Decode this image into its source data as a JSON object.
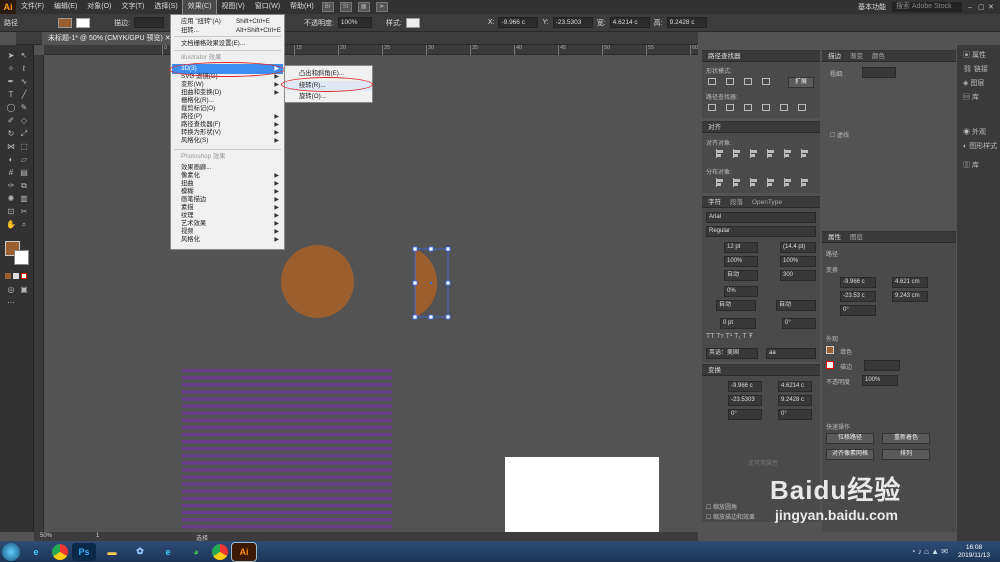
{
  "app": {
    "logo": "Ai",
    "workspace": "基本功能",
    "search_placeholder": "搜索 Adobe Stock"
  },
  "menubar": {
    "items": [
      "文件(F)",
      "编辑(E)",
      "对象(O)",
      "文字(T)",
      "选择(S)",
      "效果(C)",
      "视图(V)",
      "窗口(W)",
      "帮助(H)"
    ],
    "active": "效果(C)",
    "toolbar_icons": [
      "Br",
      "St"
    ]
  },
  "control_bar": {
    "selection": "路径",
    "fill_color": "#9b5e2c",
    "stroke_label": "描边:",
    "opacity_label": "不透明度:",
    "opacity": "100%",
    "style_label": "样式:",
    "x_label": "X:",
    "x": "-9.966 c",
    "y_label": "Y:",
    "y": "-23.5303",
    "w_label": "宽:",
    "w": "4.6214 c",
    "h_label": "高:",
    "h": "9.2428 c"
  },
  "document": {
    "tab": "未标题-1* @ 50% (CMYK/GPU 预览)",
    "zoom": "50%",
    "page": "1",
    "status": "选择"
  },
  "ruler_h": [
    "0",
    "5",
    "10",
    "15",
    "20",
    "25",
    "30",
    "35",
    "40",
    "45",
    "50",
    "55",
    "60"
  ],
  "effect_menu": {
    "items": [
      {
        "label": "应用 \"扭转\"(A)",
        "shortcut": "Shift+Ctrl+E"
      },
      {
        "label": "扭转...",
        "shortcut": "Alt+Shift+Ctrl+E"
      },
      {
        "label": "文档栅格效果设置(E)..."
      },
      {
        "label": "Illustrator 效果",
        "header": true
      },
      {
        "label": "3D(3)",
        "submenu": true,
        "highlight": true
      },
      {
        "label": "SVG 滤镜(G)",
        "submenu": true
      },
      {
        "label": "变形(W)",
        "submenu": true
      },
      {
        "label": "扭曲和变换(D)",
        "submenu": true
      },
      {
        "label": "栅格化(R)..."
      },
      {
        "label": "裁剪标记(O)"
      },
      {
        "label": "路径(P)",
        "submenu": true
      },
      {
        "label": "路径查找器(F)",
        "submenu": true
      },
      {
        "label": "转换为形状(V)",
        "submenu": true
      },
      {
        "label": "风格化(S)",
        "submenu": true
      },
      {
        "label": "Photoshop 效果",
        "header": true
      },
      {
        "label": "效果画廊..."
      },
      {
        "label": "像素化",
        "submenu": true
      },
      {
        "label": "扭曲",
        "submenu": true
      },
      {
        "label": "模糊",
        "submenu": true
      },
      {
        "label": "画笔描边",
        "submenu": true
      },
      {
        "label": "素描",
        "submenu": true
      },
      {
        "label": "纹理",
        "submenu": true
      },
      {
        "label": "艺术效果",
        "submenu": true
      },
      {
        "label": "视频",
        "submenu": true
      },
      {
        "label": "风格化",
        "submenu": true
      }
    ]
  },
  "submenu_3d": {
    "items": [
      "凸出和斜角(E)...",
      "绕转(R)...",
      "旋转(O)..."
    ],
    "highlight": "绕转(R)..."
  },
  "panels": {
    "pathfinder": {
      "title": "路径查找器",
      "shape_modes": "形状模式:",
      "expand": "扩展",
      "pathfinders": "路径查找器:"
    },
    "align": {
      "title": "对齐",
      "align_objects": "对齐对象:",
      "distribute": "分布对象:"
    },
    "character": {
      "tabs": [
        "字符",
        "段落",
        "OpenType"
      ],
      "font": "Arial",
      "style": "Regular",
      "size": "12 pt",
      "leading": "(14.4 pt)",
      "scale_h": "100%",
      "scale_v": "100%",
      "kerning": "自动",
      "tracking": "300",
      "tsume": "0%",
      "aki1": "自动",
      "aki2": "自动",
      "baseline": "0 pt",
      "rotation": "0°",
      "language": "英语：美国",
      "aa": "aa"
    },
    "transform": {
      "title": "变换",
      "x": "-9.966 c",
      "y": "-23.5303",
      "w": "4.6214 c",
      "h": "9.2428 c",
      "angle": "0°",
      "shear": "0°",
      "note": "无可用属性",
      "scale_corners": "缩放圆角",
      "scale_strokes": "缩放描边和效果"
    },
    "stroke": {
      "tabs": [
        "描边",
        "渐变",
        "颜色"
      ],
      "weight_label": "粗细:",
      "stroke_title": "虚线"
    },
    "properties": {
      "tabs": [
        "属性",
        "图层"
      ],
      "path_label": "路径",
      "transform_label": "变换",
      "x": "-9.966 c",
      "y": "-23.53 c",
      "w": "4.621 cm",
      "h": "9.243 cm",
      "angle": "0°",
      "appearance": "外观",
      "fill": "填色",
      "stroke": "描边",
      "opacity_label": "不透明度",
      "opacity": "100%",
      "quick_actions": "快速操作",
      "btn_offset": "位移路径",
      "btn_recolor": "重新着色",
      "btn_align": "对齐像素网格",
      "btn_arrange": "排列"
    },
    "side_icons": [
      "属性",
      "链接",
      "图层",
      "库",
      "外观",
      "图形样式",
      "库"
    ]
  },
  "taskbar": {
    "time": "16:08",
    "date": "2019/11/13"
  },
  "watermark": {
    "logo": "Baidu经验",
    "url": "jingyan.baidu.com"
  },
  "colors": {
    "shape_fill": "#9b5e2c",
    "stripe": "#6a3a8c",
    "highlight": "#3d8ef0",
    "annotation": "#e0282a"
  }
}
